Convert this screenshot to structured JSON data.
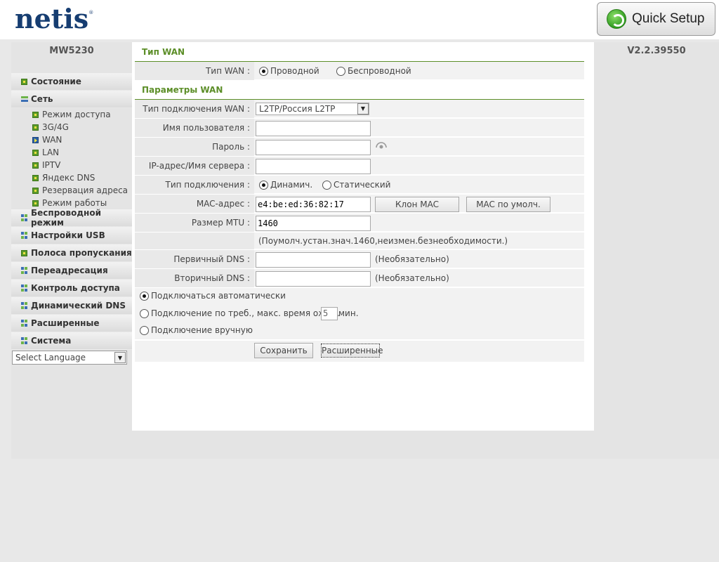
{
  "header": {
    "logo": "netis",
    "logo_mark": "®",
    "quick_setup_label": "Quick Setup"
  },
  "device": {
    "model": "MW5230",
    "version": "V2.2.39550"
  },
  "sidebar": {
    "items": [
      {
        "label": "Состояние",
        "icon": "green-square-icon"
      },
      {
        "label": "Сеть",
        "icon": "minus-expanded-icon",
        "children": [
          "Режим доступа",
          "3G/4G",
          "WAN",
          "LAN",
          "IPTV",
          "Яндекс DNS",
          "Резервация адреса",
          "Режим работы"
        ]
      },
      {
        "label": "Беспроводной режим",
        "icon": "grid-icon"
      },
      {
        "label": "Настройки USB",
        "icon": "grid-icon"
      },
      {
        "label": "Полоса пропускания",
        "icon": "green-square-icon"
      },
      {
        "label": "Переадресация",
        "icon": "grid-icon"
      },
      {
        "label": "Контроль доступа",
        "icon": "grid-icon"
      },
      {
        "label": "Динамический DNS",
        "icon": "grid-icon"
      },
      {
        "label": "Расширенные",
        "icon": "grid-icon"
      },
      {
        "label": "Система",
        "icon": "grid-icon"
      }
    ],
    "language_select": "Select Language"
  },
  "wan_type": {
    "section_title": "Тип WAN",
    "label": "Тип WAN :",
    "options": [
      "Проводной",
      "Беспроводной"
    ],
    "selected": "Проводной"
  },
  "wan_params": {
    "section_title": "Параметры WAN",
    "connection_type_label": "Тип подключения WAN :",
    "connection_type_value": "L2TP/Россия L2TP",
    "username_label": "Имя пользователя :",
    "username_value": "",
    "password_label": "Пароль :",
    "password_value": "",
    "server_label": "IP-адрес/Имя сервера :",
    "server_value": "",
    "conn_mode_label": "Тип подключения :",
    "conn_mode_options": [
      "Динамич.",
      "Статический"
    ],
    "conn_mode_selected": "Динамич.",
    "mac_label": "MAC-адрес :",
    "mac_value": "e4:be:ed:36:82:17",
    "clone_mac_button": "Клон MAC",
    "default_mac_button": "MAC по умолч.",
    "mtu_label": "Размер MTU :",
    "mtu_value": "1460",
    "mtu_hint": "(Поумолч.устан.знач.1460,неизмен.безнеобходимости.)",
    "dns1_label": "Первичный DNS :",
    "dns1_value": "",
    "dns1_hint": "(Необязательно)",
    "dns2_label": "Вторичный DNS :",
    "dns2_value": "",
    "dns2_hint": "(Необязательно)",
    "connect_auto": "Подключаться автоматически",
    "connect_on_demand": "Подключение по треб., макс. время ожид.",
    "on_demand_minutes": "5",
    "minutes_unit": "мин.",
    "connect_manual": "Подключение вручную",
    "save_button": "Сохранить",
    "advanced_button": "Расширенные"
  }
}
